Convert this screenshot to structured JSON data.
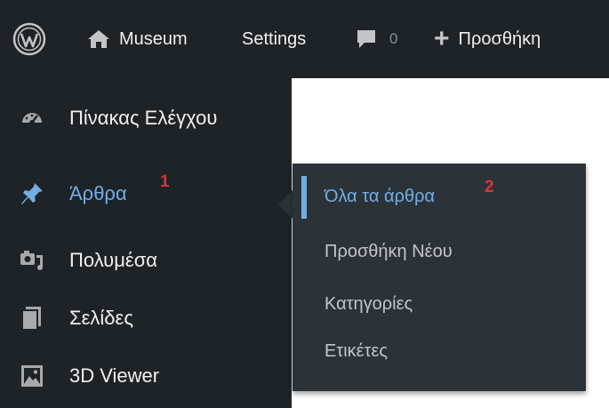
{
  "adminbar": {
    "logo_icon": "wordpress-logo-icon",
    "home_icon": "home-icon",
    "site_name": "Museum",
    "settings_label": "Settings",
    "comments_icon": "comment-bubble-icon",
    "comments_count": "0",
    "new_icon": "plus-icon",
    "new_label": "Προσθήκη"
  },
  "sidebar": {
    "items": [
      {
        "label": "Πίνακας Ελέγχου",
        "icon": "dashboard-gauge-icon"
      },
      {
        "label": "Άρθρα",
        "icon": "pushpin-icon",
        "active": true,
        "marker": "1"
      },
      {
        "label": "Πολυμέσα",
        "icon": "media-camera-icon"
      },
      {
        "label": "Σελίδες",
        "icon": "pages-icon"
      },
      {
        "label": "3D Viewer",
        "icon": "image-icon"
      }
    ]
  },
  "submenu": {
    "items": [
      {
        "label": "Όλα τα άρθρα",
        "active": true,
        "marker": "2"
      },
      {
        "label": "Προσθήκη Νέου"
      },
      {
        "label": "Κατηγορίες"
      },
      {
        "label": "Ετικέτες"
      }
    ]
  },
  "colors": {
    "bar_bg": "#1d2327",
    "flyout_bg": "#2c3338",
    "accent": "#72aee6",
    "marker_red": "#d63638"
  }
}
